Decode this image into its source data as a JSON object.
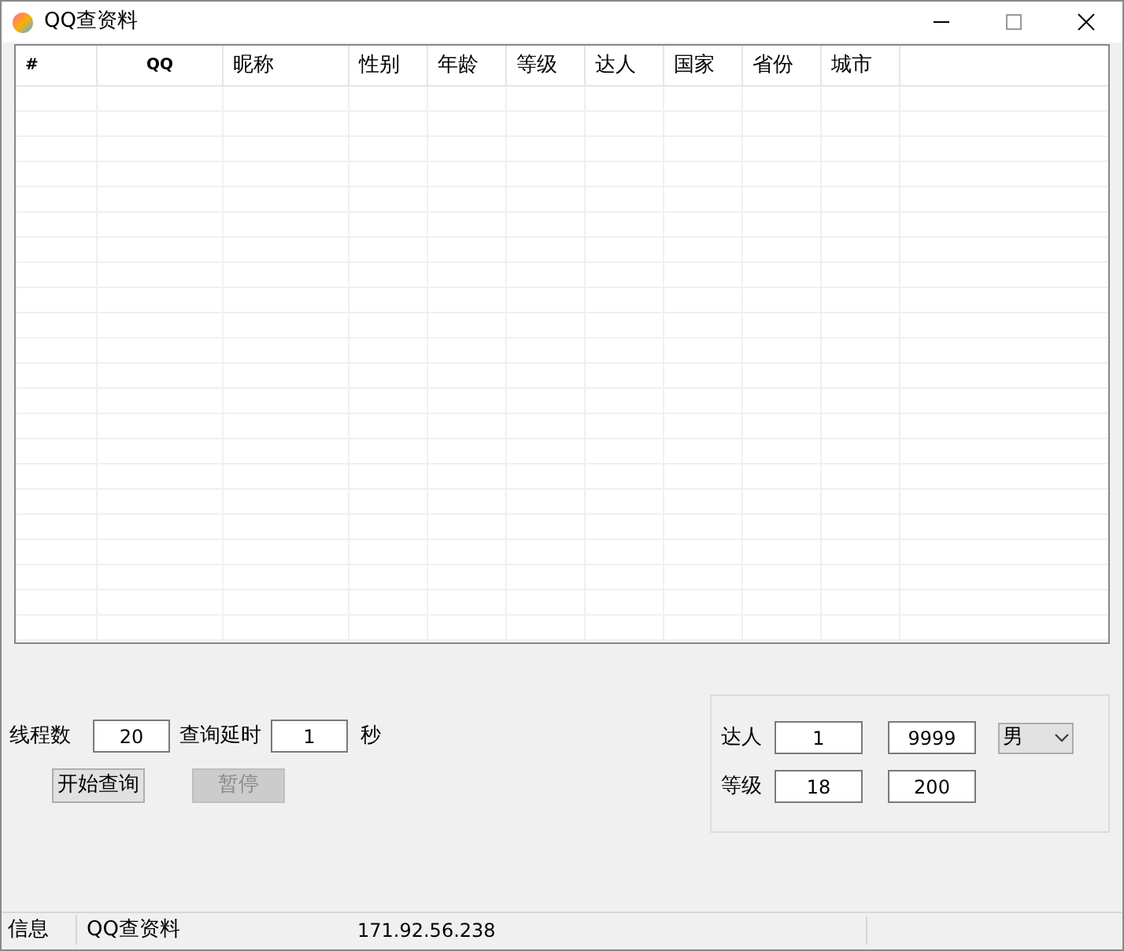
{
  "window": {
    "title": "QQ查资料"
  },
  "table": {
    "columns": [
      "#",
      "QQ",
      "昵称",
      "性别",
      "年龄",
      "等级",
      "达人",
      "国家",
      "省份",
      "城市"
    ]
  },
  "settings": {
    "threads_label": "线程数",
    "threads": "20",
    "delay_label": "查询延时",
    "delay": "1",
    "delay_unit": "秒"
  },
  "buttons": [
    {
      "label": "开始查询",
      "disabled": false
    },
    {
      "label": "暂停",
      "disabled": true
    }
  ],
  "filters": {
    "talent_label": "达人",
    "talent_min": "1",
    "talent_max": "9999",
    "gender": "男",
    "level_label": "等级",
    "level_min": "18",
    "level_max": "200"
  },
  "status_bar": [
    "信息",
    "QQ查资料",
    "171.92.56.238"
  ]
}
